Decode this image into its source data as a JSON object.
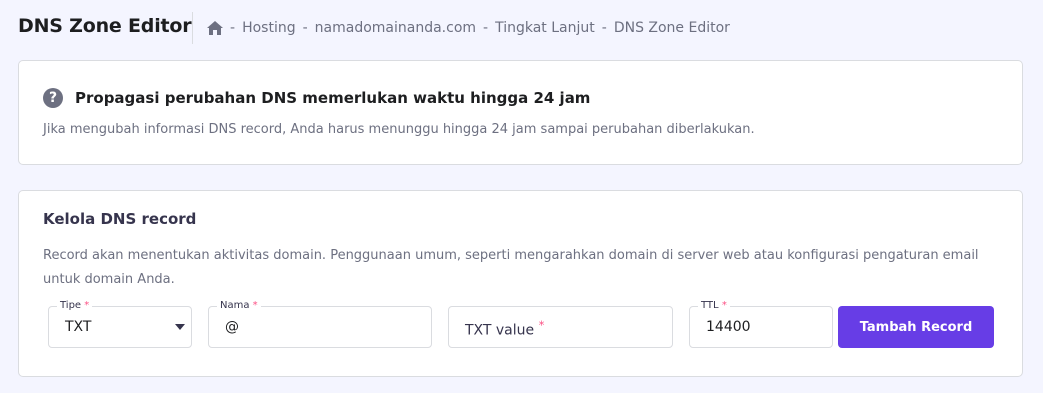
{
  "header": {
    "title": "DNS Zone Editor",
    "breadcrumb": [
      "Hosting",
      "namadomainanda.com",
      "Tingkat Lanjut",
      "DNS Zone Editor"
    ],
    "separator": "-",
    "home_icon": "home-icon"
  },
  "info_card": {
    "icon": "help-icon",
    "icon_glyph": "?",
    "title": "Propagasi perubahan DNS memerlukan waktu hingga 24 jam",
    "text": "Jika mengubah informasi DNS record, Anda harus menunggu hingga 24 jam sampai perubahan diberlakukan."
  },
  "dns_card": {
    "title": "Kelola DNS record",
    "description": "Record akan menentukan aktivitas domain. Penggunaan umum, seperti mengarahkan domain di server web atau konfigurasi pengaturan email untuk domain Anda.",
    "form": {
      "type_label": "Tipe",
      "type_value": "TXT",
      "name_label": "Nama",
      "name_value": "@",
      "value_placeholder": "TXT value",
      "ttl_label": "TTL",
      "ttl_value": "14400",
      "required_mark": "*",
      "submit_label": "Tambah Record"
    }
  },
  "colors": {
    "accent": "#673de6",
    "required": "#fc5185",
    "background": "#f4f5ff"
  }
}
